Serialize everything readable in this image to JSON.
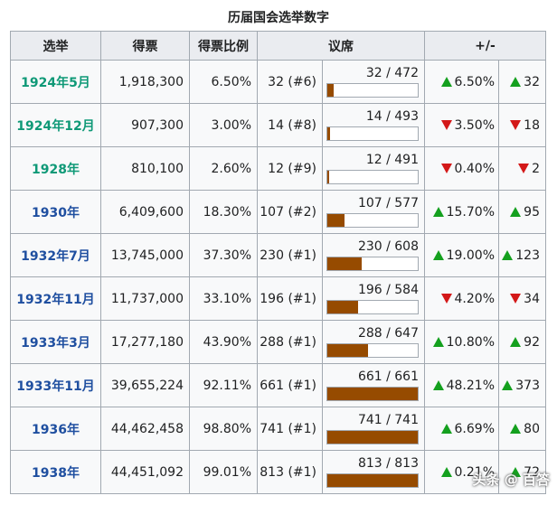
{
  "caption": "历届国会选举数字",
  "headers": {
    "election": "选举",
    "votes": "得票",
    "vote_share": "得票比例",
    "seats": "议席",
    "change": "+/-"
  },
  "rows": [
    {
      "year": "1924年5月",
      "votes": "1,918,300",
      "share": "6.50%",
      "seats": "32 (#6)",
      "frac": "32 / 472",
      "seats_won": 32,
      "seats_total": 472,
      "dir": "up",
      "chg_pct": "6.50%",
      "chg_seats": "32",
      "year_color": "#0f9977"
    },
    {
      "year": "1924年12月",
      "votes": "907,300",
      "share": "3.00%",
      "seats": "14 (#8)",
      "frac": "14 / 493",
      "seats_won": 14,
      "seats_total": 493,
      "dir": "down",
      "chg_pct": "3.50%",
      "chg_seats": "18",
      "year_color": "#0f9977"
    },
    {
      "year": "1928年",
      "votes": "810,100",
      "share": "2.60%",
      "seats": "12 (#9)",
      "frac": "12 / 491",
      "seats_won": 12,
      "seats_total": 491,
      "dir": "down",
      "chg_pct": "0.40%",
      "chg_seats": "2",
      "year_color": "#0f9977"
    },
    {
      "year": "1930年",
      "votes": "6,409,600",
      "share": "18.30%",
      "seats": "107 (#2)",
      "frac": "107 / 577",
      "seats_won": 107,
      "seats_total": 577,
      "dir": "up",
      "chg_pct": "15.70%",
      "chg_seats": "95",
      "year_color": "#1f4fa0"
    },
    {
      "year": "1932年7月",
      "votes": "13,745,000",
      "share": "37.30%",
      "seats": "230 (#1)",
      "frac": "230 / 608",
      "seats_won": 230,
      "seats_total": 608,
      "dir": "up",
      "chg_pct": "19.00%",
      "chg_seats": "123",
      "year_color": "#1f4fa0"
    },
    {
      "year": "1932年11月",
      "votes": "11,737,000",
      "share": "33.10%",
      "seats": "196 (#1)",
      "frac": "196 / 584",
      "seats_won": 196,
      "seats_total": 584,
      "dir": "down",
      "chg_pct": "4.20%",
      "chg_seats": "34",
      "year_color": "#1f4fa0"
    },
    {
      "year": "1933年3月",
      "votes": "17,277,180",
      "share": "43.90%",
      "seats": "288 (#1)",
      "frac": "288 / 647",
      "seats_won": 288,
      "seats_total": 647,
      "dir": "up",
      "chg_pct": "10.80%",
      "chg_seats": "92",
      "year_color": "#1f4fa0"
    },
    {
      "year": "1933年11月",
      "votes": "39,655,224",
      "share": "92.11%",
      "seats": "661 (#1)",
      "frac": "661 / 661",
      "seats_won": 661,
      "seats_total": 661,
      "dir": "up",
      "chg_pct": "48.21%",
      "chg_seats": "373",
      "year_color": "#1f4fa0"
    },
    {
      "year": "1936年",
      "votes": "44,462,458",
      "share": "98.80%",
      "seats": "741 (#1)",
      "frac": "741 / 741",
      "seats_won": 741,
      "seats_total": 741,
      "dir": "up",
      "chg_pct": "6.69%",
      "chg_seats": "80",
      "year_color": "#1f4fa0"
    },
    {
      "year": "1938年",
      "votes": "44,451,092",
      "share": "99.01%",
      "seats": "813 (#1)",
      "frac": "813 / 813",
      "seats_won": 813,
      "seats_total": 813,
      "dir": "up",
      "chg_pct": "0.21%",
      "chg_seats": "72",
      "year_color": "#1f4fa0"
    }
  ],
  "colors": {
    "bar_fill": "#964b00",
    "up": "#14a01e",
    "down": "#d31818"
  },
  "watermark": "头条 @ 百答"
}
